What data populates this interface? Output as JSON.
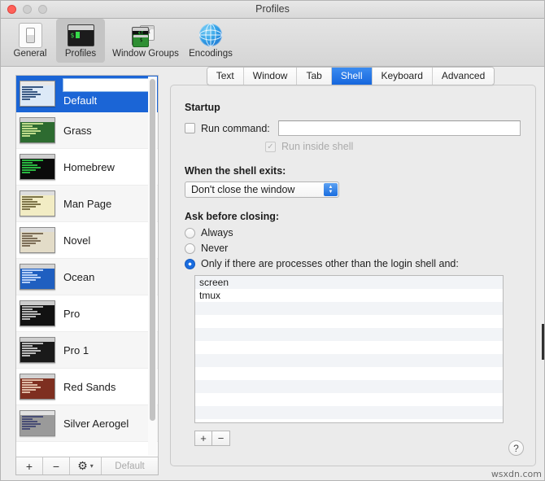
{
  "window": {
    "title": "Profiles",
    "traffic_lights": [
      "close-button",
      "minimize-button",
      "maximize-button"
    ]
  },
  "toolbar": {
    "items": [
      {
        "label": "General",
        "icon": "toggle-switch-icon",
        "selected": false
      },
      {
        "label": "Profiles",
        "icon": "terminal-window-icon",
        "selected": true
      },
      {
        "label": "Window Groups",
        "icon": "window-group-icon",
        "selected": false
      },
      {
        "label": "Encodings",
        "icon": "globe-icon",
        "selected": false
      }
    ]
  },
  "sidebar": {
    "edit_field_value": "",
    "profiles": [
      {
        "name": "Default",
        "selected": true,
        "thumb_bg": "#dce9f7",
        "thumb_fg": "#1d3f6e",
        "thumb_bar": "#e8e8e8"
      },
      {
        "name": "Grass",
        "selected": false,
        "thumb_bg": "#2d6b30",
        "thumb_fg": "#d8ee9a",
        "thumb_bar": "#d0d0d0"
      },
      {
        "name": "Homebrew",
        "selected": false,
        "thumb_bg": "#0b0b0b",
        "thumb_fg": "#2fd34a",
        "thumb_bar": "#cfcfcf"
      },
      {
        "name": "Man Page",
        "selected": false,
        "thumb_bg": "#f2ecc4",
        "thumb_fg": "#6a6034",
        "thumb_bar": "#dedede"
      },
      {
        "name": "Novel",
        "selected": false,
        "thumb_bg": "#e3dcc8",
        "thumb_fg": "#6b5a43",
        "thumb_bar": "#dcdcdc"
      },
      {
        "name": "Ocean",
        "selected": false,
        "thumb_bg": "#1f5fc0",
        "thumb_fg": "#cfe2ff",
        "thumb_bar": "#d4d4d4"
      },
      {
        "name": "Pro",
        "selected": false,
        "thumb_bg": "#121212",
        "thumb_fg": "#d4d4d4",
        "thumb_bar": "#cdcdcd"
      },
      {
        "name": "Pro 1",
        "selected": false,
        "thumb_bg": "#1a1a1a",
        "thumb_fg": "#d8d8d8",
        "thumb_bar": "#cdcdcd"
      },
      {
        "name": "Red Sands",
        "selected": false,
        "thumb_bg": "#7e2f20",
        "thumb_fg": "#f0d3bd",
        "thumb_bar": "#d2d2d2"
      },
      {
        "name": "Silver Aerogel",
        "selected": false,
        "thumb_bg": "#9a9a9a",
        "thumb_fg": "#3a3f6e",
        "thumb_bar": "#e2e2e2"
      }
    ],
    "buttons": {
      "add": "+",
      "remove": "−",
      "gear": "⚙",
      "gear_chevron": "▾",
      "set_default": "Default"
    }
  },
  "tabs": [
    {
      "label": "Text",
      "active": false
    },
    {
      "label": "Window",
      "active": false
    },
    {
      "label": "Tab",
      "active": false
    },
    {
      "label": "Shell",
      "active": true
    },
    {
      "label": "Keyboard",
      "active": false
    },
    {
      "label": "Advanced",
      "active": false
    }
  ],
  "shell_pane": {
    "startup_title": "Startup",
    "run_command_label": "Run command:",
    "run_command_checked": false,
    "run_command_value": "",
    "run_command_placeholder": "",
    "run_inside_shell_label": "Run inside shell",
    "run_inside_shell_checked": true,
    "run_inside_shell_checkmark": "✓",
    "shell_exits_label": "When the shell exits:",
    "shell_exits_value": "Don't close the window",
    "shell_exits_up_arrow": "▲",
    "shell_exits_down_arrow": "▼",
    "ask_before_closing_label": "Ask before closing:",
    "ask_options": [
      {
        "label": "Always",
        "selected": false
      },
      {
        "label": "Never",
        "selected": false
      },
      {
        "label": "Only if there are processes other than the login shell and:",
        "selected": true
      }
    ],
    "process_list": [
      "screen",
      "tmux"
    ],
    "process_list_empty_rows": 9,
    "list_add": "+",
    "list_remove": "−",
    "help_label": "?"
  },
  "watermark": "wsxdn.com"
}
